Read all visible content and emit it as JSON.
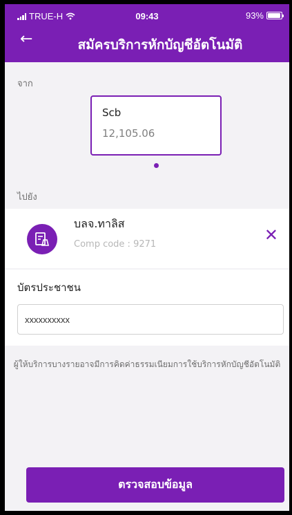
{
  "status_bar": {
    "carrier": "TRUE-H",
    "time": "09:43",
    "battery_percent": "93%",
    "battery_level": 0.93,
    "signal_icon": "signal-bars-icon",
    "wifi_icon": "wifi-icon"
  },
  "header": {
    "title": "สมัครบริการหักบัญชีอัตโนมัติ",
    "back_icon": "arrow-left-icon"
  },
  "from": {
    "label": "จาก",
    "account_name": "Scb",
    "balance": "12,105.06"
  },
  "to": {
    "label": "ไปยัง",
    "biller_name": "บลจ.ทาลิส",
    "comp_code": "Comp code : 9271",
    "biller_icon": "bill-receipt-icon",
    "remove_icon": "close-icon"
  },
  "citizen_id": {
    "label": "บัตรประชาชน",
    "value": "xxxxxxxxxx"
  },
  "note": "ผู้ให้บริการบางรายอาจมีการคิดค่าธรรมเนียมการใช้บริการหักบัญชีอัตโนมัติ",
  "submit_label": "ตรวจสอบข้อมูล",
  "colors": {
    "brand": "#7a1fb4",
    "background": "#f3f2f5"
  }
}
